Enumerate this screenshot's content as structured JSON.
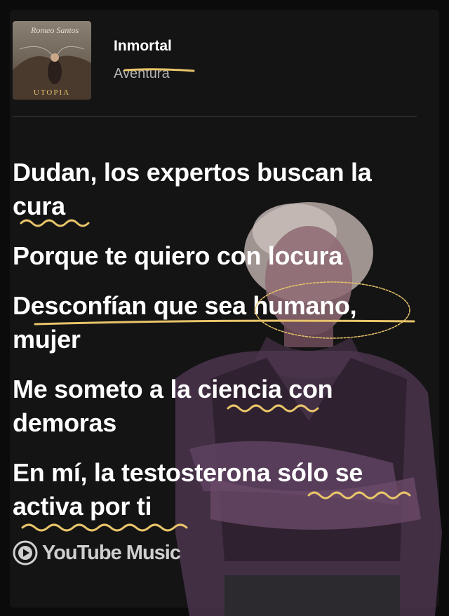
{
  "song": {
    "title": "Inmortal",
    "artist": "Aventura",
    "album_art_text": "Romeo Santos",
    "album_art_caption": "UTOPIA"
  },
  "lyrics": [
    "Dudan, los expertos buscan la cura",
    "Porque te quiero con locura",
    "Desconfían que sea humano, mujer",
    "Me someto a la ciencia con demoras",
    "En mí, la testosterona sólo se activa por ti"
  ],
  "brand": {
    "name": "YouTube Music",
    "icon": "play-circle-icon"
  },
  "colors": {
    "background": "#0b0b0b",
    "card": "#141414",
    "text": "#ffffff",
    "secondary_text": "#b3b3b3",
    "annotation": "#e8c46a",
    "figure_sweater": "#5a3d58"
  }
}
